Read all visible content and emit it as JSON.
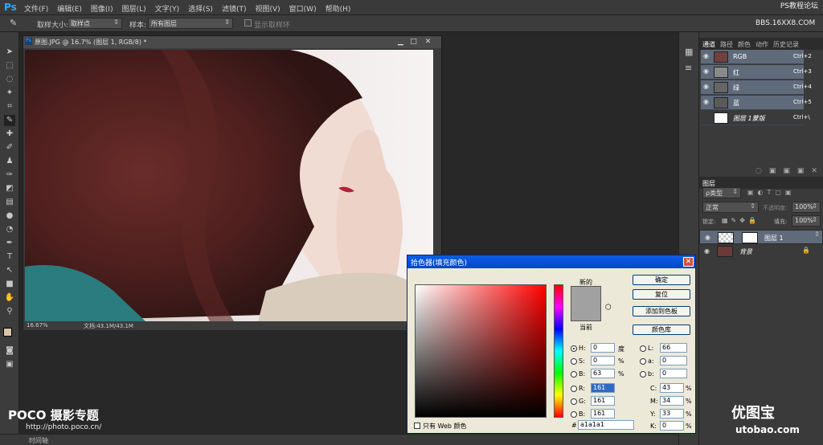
{
  "app": {
    "logo": "Ps",
    "menu": [
      "文件(F)",
      "编辑(E)",
      "图像(I)",
      "图层(L)",
      "文字(Y)",
      "选择(S)",
      "滤镜(T)",
      "视图(V)",
      "窗口(W)",
      "帮助(H)"
    ],
    "watermark_top": "PS教程论坛",
    "watermark_top2": "BBS.16XX8.COM"
  },
  "options": {
    "sample_size_label": "取样大小:",
    "sample_size_value": "取样点",
    "sample_label": "样本:",
    "sample_value": "所有图层",
    "show_ring": "显示取样环"
  },
  "document": {
    "title": "原图.JPG @ 16.7% (图层 1, RGB/8) *",
    "zoom": "16.67%",
    "docsize": "文档:43.1M/43.1M"
  },
  "channels": {
    "tabs": [
      "通道",
      "路径",
      "颜色",
      "动作",
      "历史记录"
    ],
    "rows": [
      {
        "name": "RGB",
        "shortcut": "Ctrl+2"
      },
      {
        "name": "红",
        "shortcut": "Ctrl+3"
      },
      {
        "name": "绿",
        "shortcut": "Ctrl+4"
      },
      {
        "name": "蓝",
        "shortcut": "Ctrl+5"
      },
      {
        "name": "图层 1蒙版",
        "shortcut": "Ctrl+\\"
      }
    ]
  },
  "layers": {
    "tab": "图层",
    "kind": "ρ类型",
    "blend": "正常",
    "opacity_label": "不透明度:",
    "opacity": "100%",
    "lock_label": "锁定:",
    "fill_label": "填充:",
    "fill": "100%",
    "rows": [
      {
        "name": "图层 1"
      },
      {
        "name": "背景"
      }
    ]
  },
  "picker": {
    "title": "拾色器(填充颜色)",
    "new_label": "新的",
    "current_label": "当前",
    "buttons": [
      "确定",
      "复位",
      "添加到色板",
      "颜色库"
    ],
    "H": "0",
    "H_unit": "度",
    "S": "0",
    "S_unit": "%",
    "B": "63",
    "B_unit": "%",
    "R": "161",
    "G": "161",
    "Bv": "161",
    "L": "66",
    "a": "0",
    "b": "0",
    "C": "43",
    "M": "34",
    "Y": "33",
    "K": "0",
    "pct": "%",
    "hex": "a1a1a1",
    "web_only": "只有 Web 颜色",
    "color": "#a1a1a1"
  },
  "bottom": {
    "poco": "POCO 摄影专题",
    "poco_url": "http://photo.poco.cn/",
    "timeline": "时间轴",
    "site": "utobao.com",
    "site_cn": "优图宝"
  }
}
